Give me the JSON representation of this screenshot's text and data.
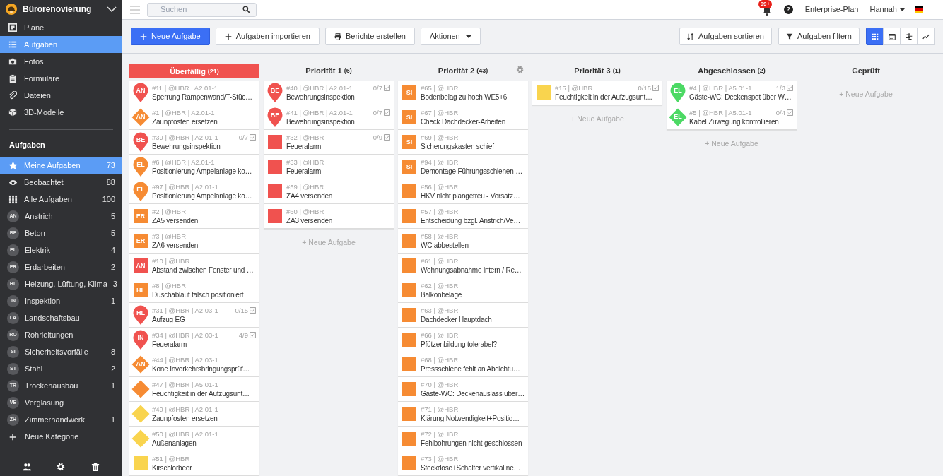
{
  "project": {
    "title": "Bürorenovierung"
  },
  "nav": [
    {
      "label": "Pläne",
      "selected": false
    },
    {
      "label": "Aufgaben",
      "selected": true
    },
    {
      "label": "Fotos",
      "selected": false
    },
    {
      "label": "Formulare",
      "selected": false
    },
    {
      "label": "Dateien",
      "selected": false
    },
    {
      "label": "3D-Modelle",
      "selected": false
    }
  ],
  "task_lists": {
    "heading": "Aufgaben",
    "items": [
      {
        "kind": "icon",
        "label": "Meine Aufgaben",
        "count": "73",
        "selected": true
      },
      {
        "kind": "icon",
        "label": "Beobachtet",
        "count": "88",
        "selected": false
      },
      {
        "kind": "icon",
        "label": "Alle Aufgaben",
        "count": "100",
        "selected": false
      },
      {
        "kind": "category",
        "badge": "AN",
        "label": "Anstrich",
        "count": "5",
        "selected": false
      },
      {
        "kind": "category",
        "badge": "BE",
        "label": "Beton",
        "count": "5",
        "selected": false
      },
      {
        "kind": "category",
        "badge": "EL",
        "label": "Elektrik",
        "count": "4",
        "selected": false
      },
      {
        "kind": "category",
        "badge": "ER",
        "label": "Erdarbeiten",
        "count": "2",
        "selected": false
      },
      {
        "kind": "category",
        "badge": "HL",
        "label": "Heizung, Lüftung, Klima",
        "count": "3",
        "selected": false
      },
      {
        "kind": "category",
        "badge": "IN",
        "label": "Inspektion",
        "count": "1",
        "selected": false
      },
      {
        "kind": "category",
        "badge": "LA",
        "label": "Landschaftsbau",
        "selected": false
      },
      {
        "kind": "category",
        "badge": "RO",
        "label": "Rohrleitungen",
        "selected": false
      },
      {
        "kind": "category",
        "badge": "SI",
        "label": "Sicherheitsvorfälle",
        "count": "8",
        "selected": false
      },
      {
        "kind": "category",
        "badge": "ST",
        "label": "Stahl",
        "count": "2",
        "selected": false
      },
      {
        "kind": "category",
        "badge": "TR",
        "label": "Trockenausbau",
        "count": "1",
        "selected": false
      },
      {
        "kind": "category",
        "badge": "VE",
        "label": "Verglasung",
        "selected": false
      },
      {
        "kind": "category",
        "badge": "ZH",
        "label": "Zimmerhandwerk",
        "count": "1",
        "selected": false
      },
      {
        "kind": "add",
        "label": "Neue Kategorie",
        "selected": false
      }
    ]
  },
  "topbar": {
    "search": {
      "placeholder": "Suchen"
    },
    "notifications": "99+",
    "help": "?",
    "plan": "Enterprise-Plan",
    "user": "Hannah"
  },
  "toolbar": {
    "left": [
      {
        "kind": "primary",
        "label": "Neue Aufgabe"
      },
      {
        "kind": "default",
        "label": "Aufgaben importieren"
      },
      {
        "kind": "default",
        "label": "Berichte erstellen"
      },
      {
        "kind": "dropdown",
        "label": "Aktionen"
      }
    ],
    "right": [
      {
        "label": "Aufgaben sortieren"
      },
      {
        "label": "Aufgaben filtern"
      }
    ],
    "views": [
      {
        "selected": true
      },
      {
        "selected": false
      },
      {
        "selected": false
      },
      {
        "selected": false
      }
    ]
  },
  "columns": [
    {
      "kind": "overdue",
      "title": "Überfällig",
      "count": "(21)",
      "hovered": false,
      "cards": [
        {
          "kind": "pin",
          "color": "#f0524f",
          "badge": "AN",
          "meta": "#11 | @HBR | A2.01-1",
          "title": "Sperrung Rampenwand/T-Stüc…"
        },
        {
          "kind": "diamond",
          "color": "#f68b33",
          "badge": "AN",
          "meta": "#1 | @HBR | A2.01-1",
          "title": "Zaunpfosten ersetzen"
        },
        {
          "kind": "pin",
          "color": "#f0524f",
          "badge": "BE",
          "meta": "#39 | @HBR | A2.01-1",
          "checklist": "0/7",
          "title": "Bewehrungsinspektion"
        },
        {
          "kind": "pin",
          "color": "#f68b33",
          "badge": "EL",
          "meta": "#6 | @HBR | A2.01-1",
          "title": "Positionierung Ampelanlage ko…"
        },
        {
          "kind": "pin",
          "color": "#f68b33",
          "badge": "EL",
          "meta": "#97 | @HBR | A2.01-1",
          "title": "Positionierung Ampelanlage ko…"
        },
        {
          "kind": "square",
          "color": "#f68b33",
          "badge": "ER",
          "meta": "#2 | @HBR",
          "title": "ZA5 versenden"
        },
        {
          "kind": "square",
          "color": "#f68b33",
          "badge": "ER",
          "meta": "#3 | @HBR",
          "title": "ZA6 versenden"
        },
        {
          "kind": "square",
          "color": "#f0524f",
          "badge": "AN",
          "meta": "#10 | @HBR",
          "title": "Abstand zwischen Fenster und …"
        },
        {
          "kind": "square",
          "color": "#f68b33",
          "badge": "HL",
          "meta": "#8 | @HBR",
          "title": "Duschablauf falsch positioniert"
        },
        {
          "kind": "pin",
          "color": "#f0524f",
          "badge": "HL",
          "meta": "#31 | @HBR | A2.03-1",
          "checklist": "0/15",
          "title": "Aufzug EG"
        },
        {
          "kind": "pin",
          "color": "#f0524f",
          "badge": "IN",
          "meta": "#34 | @HBR | A2.03-1",
          "checklist": "4/9",
          "title": "Feueralarm"
        },
        {
          "kind": "diamond",
          "color": "#f68b33",
          "badge": "AN",
          "meta": "#44 | @HBR | A2.03-1",
          "title": "Kone Inverkehrsbringungsprüf…"
        },
        {
          "kind": "diamond",
          "color": "#f68b33",
          "meta": "#47 | @HBR | A5.01-1",
          "title": "Feuchtigkeit in der Aufzugsunt…"
        },
        {
          "kind": "diamond",
          "color": "#f9d44e",
          "meta": "#49 | @HBR | A2.01-1",
          "title": "Zaunpfosten ersetzen"
        },
        {
          "kind": "diamond",
          "color": "#f9d44e",
          "meta": "#50 | @HBR | A2.01-1",
          "title": "Außenanlagen"
        },
        {
          "kind": "square",
          "color": "#f9d44e",
          "meta": "#51 | @HBR",
          "title": "Kirschlorbeer"
        }
      ]
    },
    {
      "kind": "normal",
      "title": "Priorität 1",
      "count": "(6)",
      "hovered": false,
      "add_label": "+ Neue Aufgabe",
      "cards": [
        {
          "kind": "pin",
          "color": "#f0524f",
          "badge": "BE",
          "meta": "#40 | @HBR | A2.01-1",
          "checklist": "0/7",
          "title": "Bewehrungsinspektion"
        },
        {
          "kind": "pin",
          "color": "#f0524f",
          "badge": "BE",
          "meta": "#41 | @HBR | A2.01-1",
          "checklist": "0/7",
          "title": "Bewehrungsinspektion"
        },
        {
          "kind": "square",
          "color": "#f0524f",
          "meta": "#32 | @HBR",
          "checklist": "0/9",
          "title": "Feueralarm"
        },
        {
          "kind": "square",
          "color": "#f0524f",
          "meta": "#33 | @HBR",
          "title": "Feueralarm"
        },
        {
          "kind": "square",
          "color": "#f0524f",
          "meta": "#59 | @HBR",
          "title": "ZA4 versenden"
        },
        {
          "kind": "square",
          "color": "#f0524f",
          "meta": "#60 | @HBR",
          "title": "ZA3 versenden"
        }
      ]
    },
    {
      "kind": "normal",
      "title": "Priorität 2",
      "count": "(43)",
      "hovered": true,
      "cards": [
        {
          "kind": "square",
          "color": "#f68b33",
          "badge": "SI",
          "meta": "#65 | @HBR",
          "title": "Bodenbelag zu hoch WE5+6"
        },
        {
          "kind": "square",
          "color": "#f68b33",
          "badge": "SI",
          "meta": "#67 | @HBR",
          "title": "Check Dachdecker-Arbeiten"
        },
        {
          "kind": "square",
          "color": "#f68b33",
          "badge": "SI",
          "meta": "#69 | @HBR",
          "title": "Sicherungskasten schief"
        },
        {
          "kind": "square",
          "color": "#f68b33",
          "badge": "SI",
          "meta": "#94 | @HBR",
          "title": "Demontage Führungsschienen …"
        },
        {
          "kind": "square",
          "color": "#f68b33",
          "meta": "#56 | @HBR",
          "title": "HKV nicht plangetreu - Vorsatz…"
        },
        {
          "kind": "square",
          "color": "#f68b33",
          "meta": "#57 | @HBR",
          "title": "Entscheidung bzgl. Anstrich/Ve…"
        },
        {
          "kind": "square",
          "color": "#f68b33",
          "meta": "#58 | @HBR",
          "title": "WC abbestellen"
        },
        {
          "kind": "square",
          "color": "#f68b33",
          "meta": "#61 | @HBR",
          "title": "Wohnungsabnahme intern / Re…"
        },
        {
          "kind": "square",
          "color": "#f68b33",
          "meta": "#62 | @HBR",
          "title": "Balkonbeläge"
        },
        {
          "kind": "square",
          "color": "#f68b33",
          "meta": "#63 | @HBR",
          "title": "Dachdecker Hauptdach"
        },
        {
          "kind": "square",
          "color": "#f68b33",
          "meta": "#66 | @HBR",
          "title": "Pfützenbildung tolerabel?"
        },
        {
          "kind": "square",
          "color": "#f68b33",
          "meta": "#68 | @HBR",
          "title": "Pressschiene fehlt an Abdichtu…"
        },
        {
          "kind": "square",
          "color": "#f68b33",
          "meta": "#70 | @HBR",
          "title": "Gäste-WC: Deckenauslass über…"
        },
        {
          "kind": "square",
          "color": "#f68b33",
          "meta": "#71 | @HBR",
          "title": "Klärung Notwendigkeit+Positio…"
        },
        {
          "kind": "square",
          "color": "#f68b33",
          "meta": "#72 | @HBR",
          "title": "Fehlbohrungen nicht geschlossen"
        },
        {
          "kind": "square",
          "color": "#f68b33",
          "meta": "#73 | @HBR",
          "title": "Steckdose+Schalter vertikal ne…"
        }
      ]
    },
    {
      "kind": "normal",
      "title": "Priorität 3",
      "count": "(1)",
      "hovered": false,
      "add_label": "+ Neue Aufgabe",
      "cards": [
        {
          "kind": "square",
          "color": "#f9d44e",
          "meta": "#15 | @HBR",
          "checklist": "0/15",
          "title": "Feuchtigkeit in der Aufzugsunt…"
        }
      ]
    },
    {
      "kind": "normal",
      "title": "Abgeschlossen",
      "count": "(2)",
      "hovered": false,
      "add_label": "+ Neue Aufgabe",
      "cards": [
        {
          "kind": "pin",
          "color": "#4cd964",
          "badge": "EL",
          "meta": "#4 | @HBR | A5.01-1",
          "checklist": "1/3",
          "title": "Gäste-WC: Deckenspot über W…"
        },
        {
          "kind": "diamond",
          "color": "#4cd964",
          "badge": "EL",
          "meta": "#5 | @HBR | A5.01-1",
          "checklist": "0/4",
          "title": "Kabel Zuwegung kontrollieren"
        }
      ]
    },
    {
      "kind": "normal",
      "title": "Geprüft",
      "hovered": false,
      "add_label": "+ Neue Aufgabe"
    }
  ]
}
